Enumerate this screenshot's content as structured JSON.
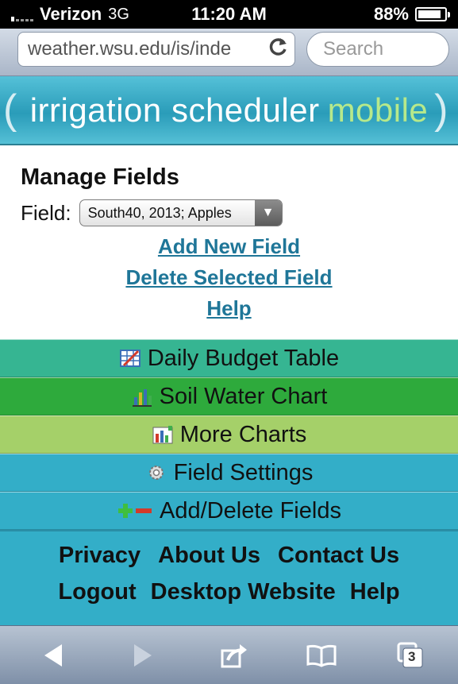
{
  "status_bar": {
    "carrier": "Verizon",
    "network": "3G",
    "time": "11:20 AM",
    "battery": "88%"
  },
  "browser": {
    "url": "weather.wsu.edu/is/inde",
    "search_placeholder": "Search",
    "tab_count": "3"
  },
  "banner": {
    "title_main": "irrigation scheduler",
    "title_accent": "mobile"
  },
  "manage": {
    "title": "Manage Fields",
    "field_label": "Field:",
    "field_value": "South40, 2013; Apples",
    "links": {
      "add": "Add New Field",
      "delete": "Delete Selected Field",
      "help": "Help"
    }
  },
  "menu": {
    "budget": "Daily Budget Table",
    "soil": "Soil Water Chart",
    "more": "More Charts",
    "settings": "Field Settings",
    "add_delete": "Add/Delete Fields"
  },
  "footer": {
    "privacy": "Privacy",
    "about": "About Us",
    "contact": "Contact Us",
    "logout": "Logout",
    "desktop": "Desktop Website",
    "help": "Help"
  },
  "icons": {
    "budget": "table-icon",
    "soil": "bar-chart-icon",
    "more": "charts-icon",
    "settings": "gear-icon",
    "add_delete": "plus-minus-icon"
  },
  "colors": {
    "banner": "#2a9cb9",
    "budget": "#36b592",
    "soil": "#2eaa3c",
    "more": "#a5d069",
    "settings": "#33aec8",
    "link": "#1f7698"
  }
}
